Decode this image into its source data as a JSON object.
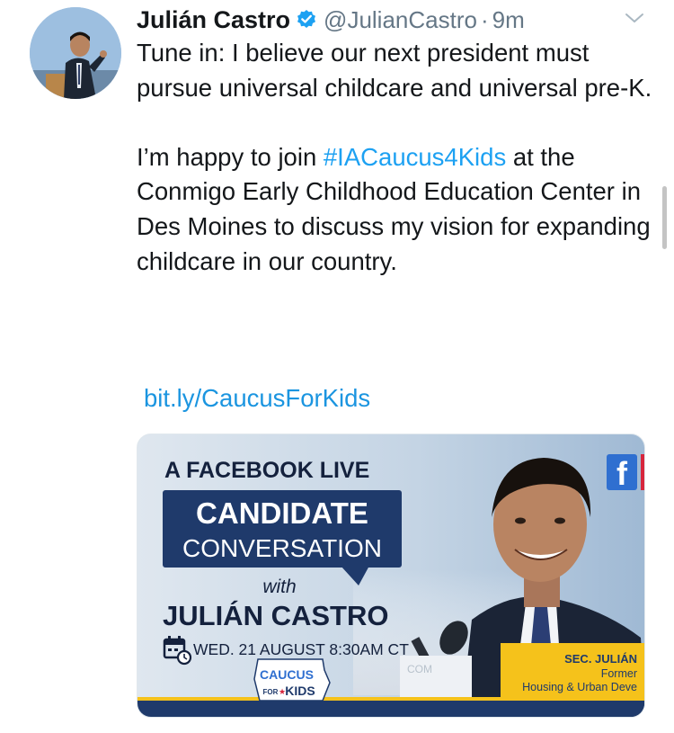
{
  "tweet": {
    "display_name": "Julián Castro",
    "handle": "@JulianCastro",
    "separator": "·",
    "time": "9m",
    "text_line1": "Tune in: I believe our next president must pursue universal childcare and universal pre-K.",
    "text_p2_before": "I’m happy to join ",
    "hashtag": "#IACaucus4Kids",
    "text_p2_after": " at the Conmigo Early Childhood Education Center in Des Moines to discuss my vision for expanding childcare in our country.",
    "link": "bit.ly/CaucusForKids"
  },
  "card": {
    "line1": "A FACEBOOK LIVE",
    "line2": "CANDIDATE",
    "line3": "CONVERSATION",
    "with": "with",
    "name": "JULIÁN CASTRO",
    "date": "WED. 21 AUGUST 8:30AM CT",
    "logo_top": "CAUCUS",
    "logo_for": "FOR",
    "logo_bottom": "KIDS",
    "fb_letter": "f",
    "badge_title": "SEC. JULIÁN",
    "badge_line2": "Former",
    "badge_line3": "Housing & Urban Deve",
    "podium_text": "COM"
  },
  "colors": {
    "link_blue": "#1b95e0",
    "hashtag_blue": "#1da1f2",
    "verified_blue": "#1da1f2",
    "navy": "#1f3a6b",
    "gold": "#f5c21b",
    "secondary_text": "#657786"
  },
  "icons": {
    "verified": "verified-badge-icon",
    "chevron": "chevron-down-icon",
    "calendar": "calendar-clock-icon",
    "facebook": "facebook-icon"
  }
}
